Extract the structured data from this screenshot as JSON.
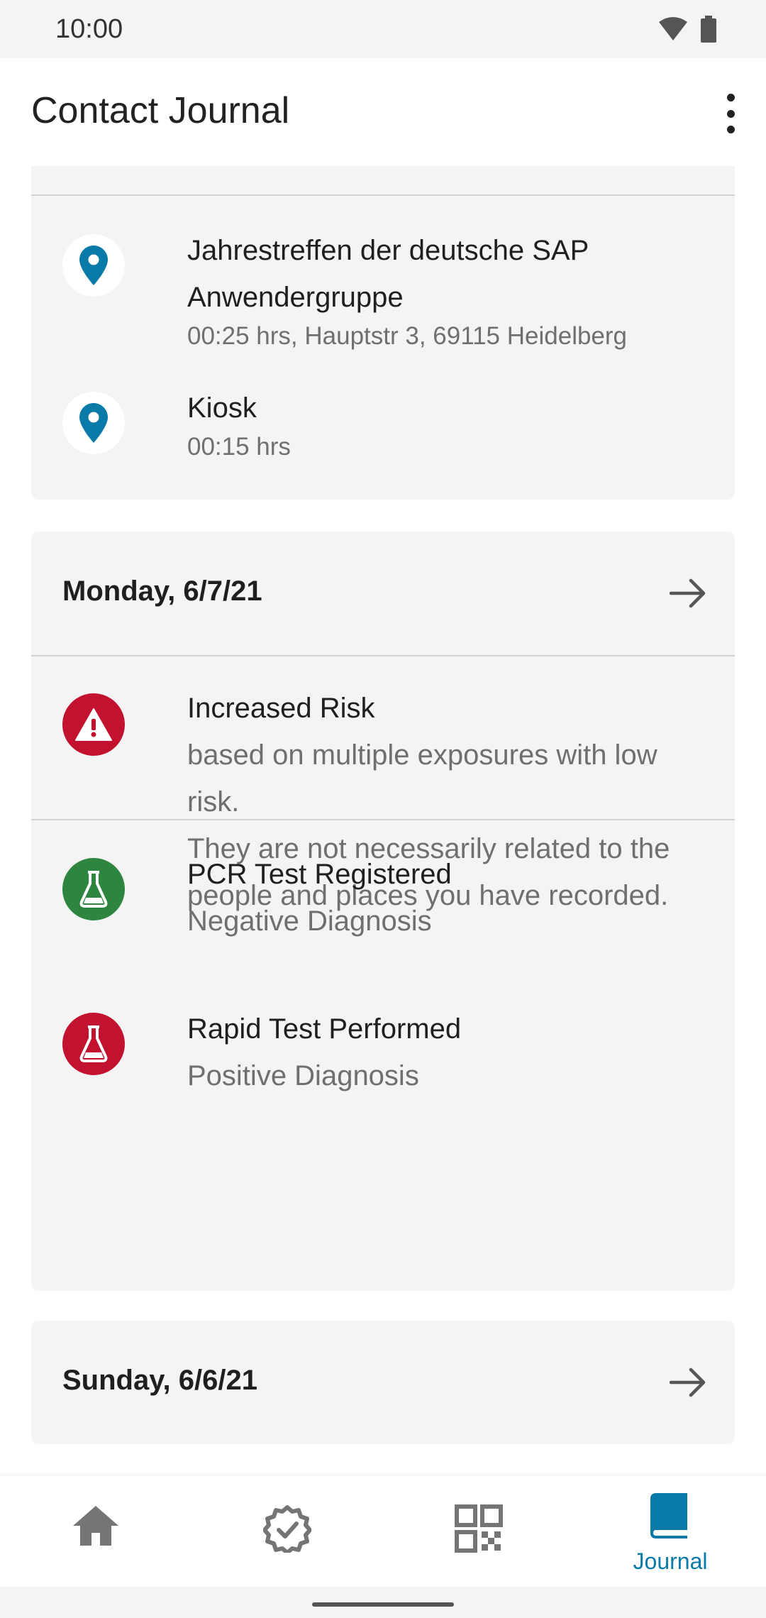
{
  "status_bar": {
    "time": "10:00"
  },
  "app_bar": {
    "title": "Contact Journal"
  },
  "section1": {
    "entries": [
      {
        "title_line1": "Jahrestreffen der deutsche SAP",
        "title_line2": "Anwendergruppe",
        "detail": "00:25 hrs, Hauptstr 3, 69115 Heidelberg",
        "icon": "location-pin-icon"
      },
      {
        "title_line1": "Kiosk",
        "detail": "00:15 hrs",
        "icon": "location-pin-icon"
      }
    ]
  },
  "day_monday": {
    "label": "Monday, 6/7/21",
    "risk": {
      "title": "Increased Risk",
      "lines": [
        "based on multiple exposures with low",
        "risk.",
        "They are not necessarily related to the",
        "people and places you have recorded."
      ]
    },
    "tests": [
      {
        "title": "PCR Test Registered",
        "result": "Negative Diagnosis",
        "color": "#2e8540"
      },
      {
        "title": "Rapid Test Performed",
        "result": "Positive Diagnosis",
        "color": "#c3122f"
      }
    ]
  },
  "day_sunday": {
    "label": "Sunday, 6/6/21"
  },
  "bottom_nav": {
    "items": [
      {
        "icon": "home-icon"
      },
      {
        "icon": "certificate-icon"
      },
      {
        "icon": "qr-code-icon"
      },
      {
        "icon": "journal-icon",
        "label": "Journal"
      }
    ]
  },
  "colors": {
    "accent": "#0a7aa8",
    "risk_red": "#c3122f",
    "ok_green": "#2e8540",
    "card_bg": "#f4f4f4"
  }
}
